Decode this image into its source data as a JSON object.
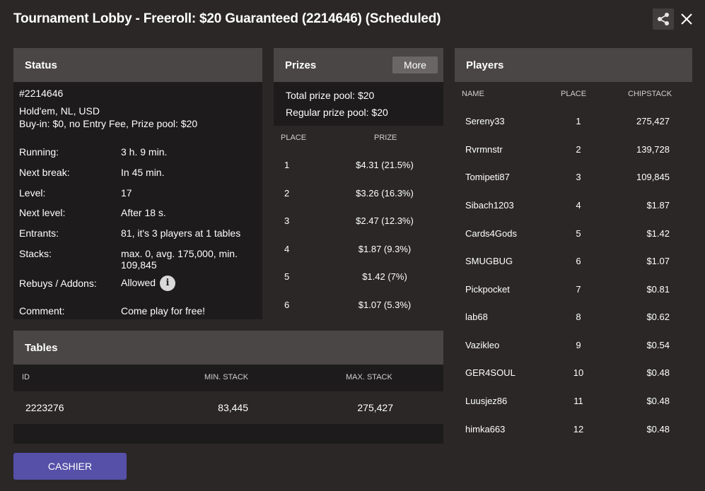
{
  "header": {
    "title": "Tournament Lobby - Freeroll: $20 Guaranteed (2214646) (Scheduled)"
  },
  "status": {
    "heading": "Status",
    "tournament_id": "#2214646",
    "game_type": "Hold'em, NL, USD",
    "buyin_line": "Buy-in: $0, no Entry Fee, Prize pool: $20",
    "rows": [
      {
        "key": "Running:",
        "value": "3 h. 9 min."
      },
      {
        "key": "Next break:",
        "value": "In 45 min."
      },
      {
        "key": "Level:",
        "value": "17"
      },
      {
        "key": "Next level:",
        "value": "After 18 s."
      },
      {
        "key": "Entrants:",
        "value": "81, it's 3 players at 1 tables"
      },
      {
        "key": "Stacks:",
        "value": "max. 0, avg. 175,000, min. 109,845"
      },
      {
        "key": "Rebuys / Addons:",
        "value": "Allowed"
      },
      {
        "key": "Comment:",
        "value": "Come play for free!"
      }
    ]
  },
  "prizes": {
    "heading": "Prizes",
    "more_label": "More",
    "total_label": "Total prize pool:",
    "total_value": "$20",
    "regular_label": "Regular prize pool:",
    "regular_value": "$20",
    "col_place": "PLACE",
    "col_prize": "PRIZE",
    "rows": [
      {
        "place": "1",
        "prize": "$4.31 (21.5%)"
      },
      {
        "place": "2",
        "prize": "$3.26 (16.3%)"
      },
      {
        "place": "3",
        "prize": "$2.47 (12.3%)"
      },
      {
        "place": "4",
        "prize": "$1.87 (9.3%)"
      },
      {
        "place": "5",
        "prize": "$1.42 (7%)"
      },
      {
        "place": "6",
        "prize": "$1.07 (5.3%)"
      }
    ]
  },
  "players": {
    "heading": "Players",
    "col_name": "NAME",
    "col_place": "PLACE",
    "col_chipstack": "CHIPSTACK",
    "rows": [
      {
        "name": "Sereny33",
        "place": "1",
        "chips": "275,427"
      },
      {
        "name": "Rvrmnstr",
        "place": "2",
        "chips": "139,728"
      },
      {
        "name": "Tomipeti87",
        "place": "3",
        "chips": "109,845"
      },
      {
        "name": "Sibach1203",
        "place": "4",
        "chips": "$1.87"
      },
      {
        "name": "Cards4Gods",
        "place": "5",
        "chips": "$1.42"
      },
      {
        "name": "SMUGBUG",
        "place": "6",
        "chips": "$1.07"
      },
      {
        "name": "Pickpocket",
        "place": "7",
        "chips": "$0.81"
      },
      {
        "name": "lab68",
        "place": "8",
        "chips": "$0.62"
      },
      {
        "name": "Vazikleo",
        "place": "9",
        "chips": "$0.54"
      },
      {
        "name": "GER4SOUL",
        "place": "10",
        "chips": "$0.48"
      },
      {
        "name": "Luusjez86",
        "place": "11",
        "chips": "$0.48"
      },
      {
        "name": "himka663",
        "place": "12",
        "chips": "$0.48"
      }
    ]
  },
  "tables": {
    "heading": "Tables",
    "col_id": "ID",
    "col_min": "MIN. STACK",
    "col_max": "MAX. STACK",
    "rows": [
      {
        "id": "2223276",
        "min": "83,445",
        "max": "275,427"
      }
    ]
  },
  "footer": {
    "cashier_label": "Cashier"
  },
  "colors": {
    "background": "#2b2727",
    "panel_header": "#4a4646",
    "panel_body": "#1d1b1b",
    "cashier_button": "#5650a8"
  }
}
